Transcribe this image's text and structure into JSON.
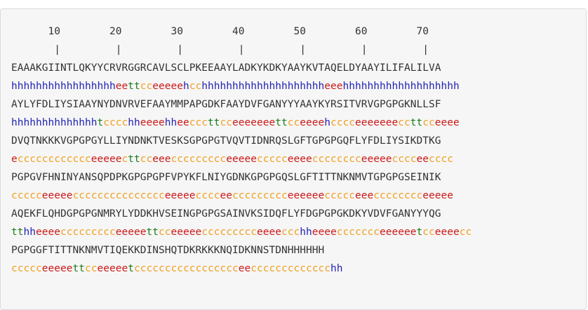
{
  "ruler": {
    "numbers": "      10        20        30        40        50        60        70",
    "ticks": "       |         |         |         |         |         |         |"
  },
  "rows": [
    {
      "sequence": "EAAAKGIINTLQKYYCRVRGGRCAVLSCLPKEEAAYLADKYKDKYAAYKVTAQELDYAAYILIFALILVA",
      "structure": "hhhhhhhhhhhhhhhhheettcceeeeehcchhhhhhhhhhhhhhhhhhhheeehhhhhhhhhhhhhhhhhhh"
    },
    {
      "sequence": "AYLYFDLIYSIAAYNYDNVRVEFAAYMMPAPGDKFAAYDVFGANYYYAAYKYRSITVRVGPGPGKNLLSF",
      "structure": "hhhhhhhhhhhhhhtcccchheeeehheecccttcceeeeeeettcceeeehcccceeeeeeeccttcceeee"
    },
    {
      "sequence": "DVQTNKKKVGPGPGYLLIYNDNKTVESKSGPGPGTVQVTIDNRQSLGFTGPGPGQFLYFDLIYSIKDTKG",
      "structure": "ecccccccccccceeeeecttcceeeccccccccceeeeeccccceeeecccccccceeeeecccceecccc"
    },
    {
      "sequence": "PGPGVFHNINYANSQPDPKGPGPGPFVPYKFLNIYGDNKGPGPGQSLGFTITTNKNMVTGPGPGSEINIK",
      "structure": "ccccceeeeeccccccccccccccceeeeecccceeccccccccceeeeeeccccceeecccccccceeeee"
    },
    {
      "sequence": "AQEKFLQHDGPGPGNMRYLYDDKHVSEINGPGPGSAINVKSIDQFLYFDGPGPGKDKYVDVFGANYYYQG",
      "structure": "tthheeeeccccccccceeeeettcceeeeeccccccccceeeeccchheeeeccccccceeeeeetcceeeecc"
    },
    {
      "sequence": "PGPGGFTITTNKNMVTIQEKKDINSHQTDKRKKKNQIDKNNSTDNHHHHHH",
      "structure": "ccccceeeeettcceeeeetccccccccccccccccceeccccccccccccchh"
    }
  ],
  "colors": {
    "h": "#1f1fb3",
    "e": "#cc1a1a",
    "t": "#1a7a1a",
    "c": "#f0a020",
    "sequence_text": "#333333",
    "panel_background": "#f6f6f6"
  }
}
